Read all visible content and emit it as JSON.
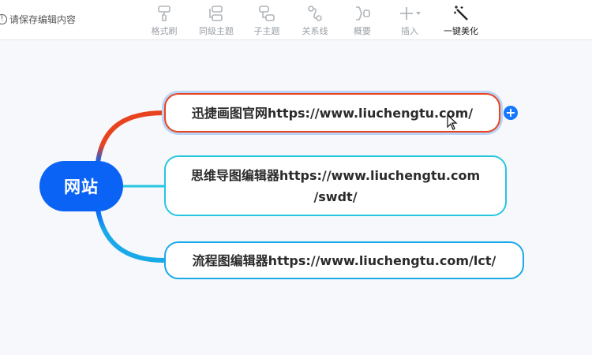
{
  "toolbar": {
    "save_hint": "请保存编辑内容",
    "tools": [
      {
        "label": "格式刷",
        "icon": "format-brush-icon"
      },
      {
        "label": "同级主题",
        "icon": "sibling-topic-icon"
      },
      {
        "label": "子主题",
        "icon": "subtopic-icon"
      },
      {
        "label": "关系线",
        "icon": "relation-line-icon"
      },
      {
        "label": "概要",
        "icon": "summary-icon"
      },
      {
        "label": "插入",
        "icon": "insert-icon"
      },
      {
        "label": "一键美化",
        "icon": "magic-wand-icon"
      }
    ]
  },
  "mindmap": {
    "root": "网站",
    "branches": [
      {
        "line1": "迅捷画图官网https://www.liuchengtu.com/",
        "line2": "",
        "color": "#e8431f"
      },
      {
        "line1": "思维导图编辑器https://www.liuchengtu.com",
        "line2": "/swdt/",
        "color": "#27c6e0"
      },
      {
        "line1": "流程图编辑器https://www.liuchengtu.com/lct/",
        "line2": "",
        "color": "#1aa9e8"
      }
    ],
    "add_button": "+"
  },
  "colors": {
    "root": "#0b63f6",
    "accent": "#1677ff"
  }
}
